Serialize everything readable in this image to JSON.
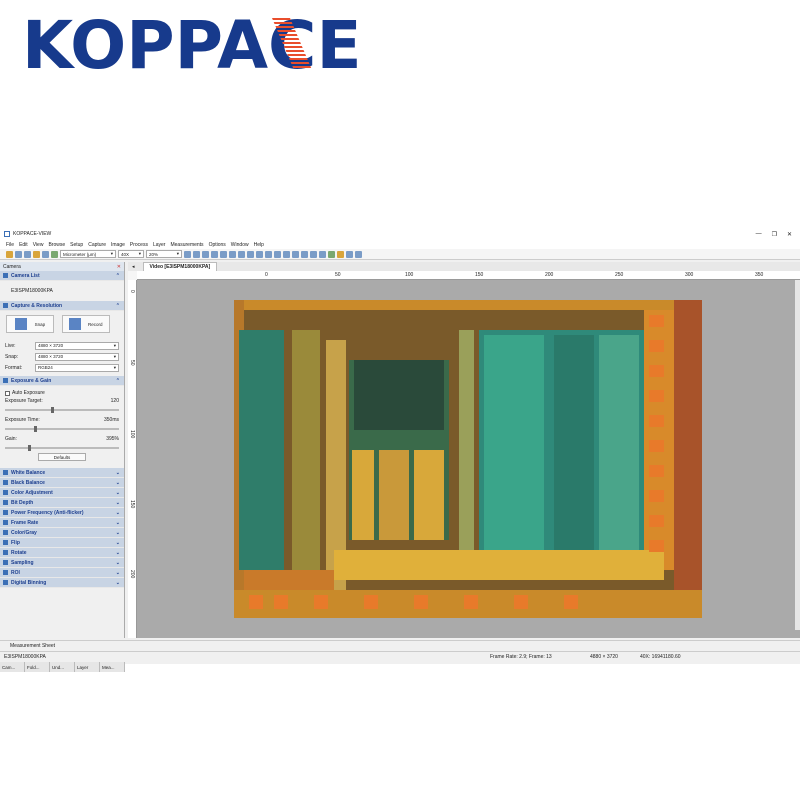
{
  "logo": {
    "text": "KOPPACE",
    "color": "#173a8c",
    "accent": "#e94e2c"
  },
  "window": {
    "title": "KOPPACE-VIEW",
    "controls": [
      "—",
      "❐",
      "✕"
    ]
  },
  "menu": [
    "File",
    "Edit",
    "View",
    "Browse",
    "Setup",
    "Capture",
    "Image",
    "Process",
    "Layer",
    "Measurements",
    "Options",
    "Window",
    "Help"
  ],
  "toolbar": {
    "unit": "Micrometer (μm)",
    "magnification": "40X",
    "zoom": "20%"
  },
  "camera_panel": {
    "title": "Camera",
    "camera_list": {
      "title": "Camera List",
      "device": "E3ISPM18000KPA"
    },
    "capture": {
      "title": "Capture & Resolution",
      "snap_label": "Snap",
      "record_label": "Record",
      "live_label": "Live:",
      "live_value": "4880 × 3720",
      "snap_res_label": "Snap:",
      "snap_value": "4880 × 3720",
      "format_label": "Format:",
      "format_value": "RGB24"
    },
    "exposure": {
      "title": "Exposure & Gain",
      "auto_label": "Auto Exposure",
      "target_label": "Exposure Target:",
      "target_value": "120",
      "time_label": "Exposure Time:",
      "time_value": "350ms",
      "gain_label": "Gain:",
      "gain_value": "395%",
      "defaults_label": "Defaults",
      "target_level": 0.4,
      "time_level": 0.25,
      "gain_level": 0.2
    },
    "sections": [
      "White Balance",
      "Black Balance",
      "Color Adjustment",
      "Bit Depth",
      "Power Frequency (Anti-flicker)",
      "Frame Rate",
      "Color/Gray",
      "Flip",
      "Rotate",
      "Sampling",
      "ROI",
      "Digital Binning"
    ],
    "bottom_tabs": [
      "Cam...",
      "Fold...",
      "Und...",
      "Layer",
      "Mea..."
    ]
  },
  "document": {
    "tab_title": "Video [E3ISPM18000KPA]",
    "h_ticks": [
      "0",
      "50",
      "100",
      "150",
      "200",
      "250",
      "300",
      "350"
    ],
    "v_ticks": [
      "0",
      "50",
      "100",
      "150",
      "200"
    ]
  },
  "measurement_sheet": "Measurement Sheet",
  "status": {
    "device": "E3ISPM18000KPA",
    "frame_rate": "Frame Rate: 2.9; Frame: 13",
    "resolution": "4880 × 3720",
    "scale": "40X: 16941180.60"
  }
}
